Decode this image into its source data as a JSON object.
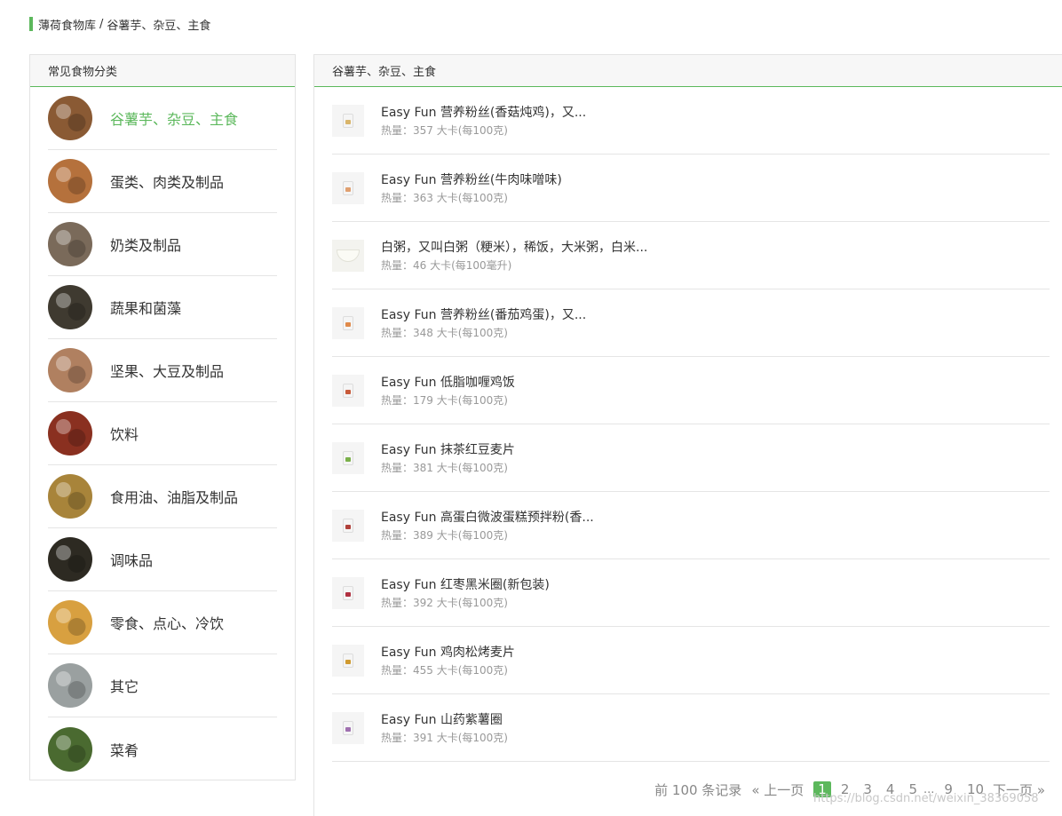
{
  "breadcrumb": {
    "root": "薄荷食物库",
    "separator": "/",
    "current": "谷薯芋、杂豆、主食"
  },
  "sidebar": {
    "title": "常见食物分类",
    "categories": [
      {
        "label": "谷薯芋、杂豆、主食",
        "active": true,
        "icon": "grain-category-icon",
        "color": "#8a5a34"
      },
      {
        "label": "蛋类、肉类及制品",
        "active": false,
        "icon": "egg-category-icon",
        "color": "#b5713c"
      },
      {
        "label": "奶类及制品",
        "active": false,
        "icon": "milk-category-icon",
        "color": "#7a6a5a"
      },
      {
        "label": "蔬果和菌藻",
        "active": false,
        "icon": "vegetable-category-icon",
        "color": "#3f3a30"
      },
      {
        "label": "坚果、大豆及制品",
        "active": false,
        "icon": "nut-category-icon",
        "color": "#b08060"
      },
      {
        "label": "饮料",
        "active": false,
        "icon": "drink-category-icon",
        "color": "#8a3020"
      },
      {
        "label": "食用油、油脂及制品",
        "active": false,
        "icon": "oil-category-icon",
        "color": "#a8843a"
      },
      {
        "label": "调味品",
        "active": false,
        "icon": "seasoning-category-icon",
        "color": "#2d2a22"
      },
      {
        "label": "零食、点心、冷饮",
        "active": false,
        "icon": "snack-category-icon",
        "color": "#d8a040"
      },
      {
        "label": "其它",
        "active": false,
        "icon": "other-category-icon",
        "color": "#9aa0a0"
      },
      {
        "label": "菜肴",
        "active": false,
        "icon": "dish-category-icon",
        "color": "#4a6a30"
      }
    ]
  },
  "main": {
    "title": "谷薯芋、杂豆、主食",
    "foods": [
      {
        "name": "Easy Fun 营养粉丝(香菇炖鸡)，又...",
        "calories": "热量：357 大卡(每100克)",
        "icon": "food-package-icon",
        "color": "#d9b56a",
        "bowl": false
      },
      {
        "name": "Easy Fun 营养粉丝(牛肉味噌味)",
        "calories": "热量：363 大卡(每100克)",
        "icon": "food-package-icon",
        "color": "#e0a070",
        "bowl": false
      },
      {
        "name": "白粥，又叫白粥（粳米），稀饭，大米粥，白米...",
        "calories": "热量：46 大卡(每100毫升)",
        "icon": "porridge-bowl-icon",
        "color": "#f0efe4",
        "bowl": true
      },
      {
        "name": "Easy Fun 营养粉丝(番茄鸡蛋)，又...",
        "calories": "热量：348 大卡(每100克)",
        "icon": "food-package-icon",
        "color": "#e08a4a",
        "bowl": false
      },
      {
        "name": "Easy Fun 低脂咖喱鸡饭",
        "calories": "热量：179 大卡(每100克)",
        "icon": "food-package-icon",
        "color": "#c85a3a",
        "bowl": false
      },
      {
        "name": "Easy Fun 抹茶红豆麦片",
        "calories": "热量：381 大卡(每100克)",
        "icon": "food-package-icon",
        "color": "#7ab04a",
        "bowl": false
      },
      {
        "name": "Easy Fun 高蛋白微波蛋糕预拌粉(香...",
        "calories": "热量：389 大卡(每100克)",
        "icon": "food-package-icon",
        "color": "#b0403a",
        "bowl": false
      },
      {
        "name": "Easy Fun 红枣黑米圈(新包装)",
        "calories": "热量：392 大卡(每100克)",
        "icon": "food-package-icon",
        "color": "#b03040",
        "bowl": false
      },
      {
        "name": "Easy Fun 鸡肉松烤麦片",
        "calories": "热量：455 大卡(每100克)",
        "icon": "food-package-icon",
        "color": "#d09a30",
        "bowl": false
      },
      {
        "name": "Easy Fun 山药紫薯圈",
        "calories": "热量：391 大卡(每100克)",
        "icon": "food-package-icon",
        "color": "#a070b0",
        "bowl": false
      }
    ]
  },
  "pagination": {
    "total": "前 100 条记录",
    "prev": "« 上一页",
    "pages": [
      "1",
      "2",
      "3",
      "4",
      "5"
    ],
    "current": "1",
    "ellipsis": "...",
    "tail_pages": [
      "9",
      "10"
    ],
    "next": "下一页 »"
  },
  "watermark": "https://blog.csdn.net/weixin_38369058"
}
